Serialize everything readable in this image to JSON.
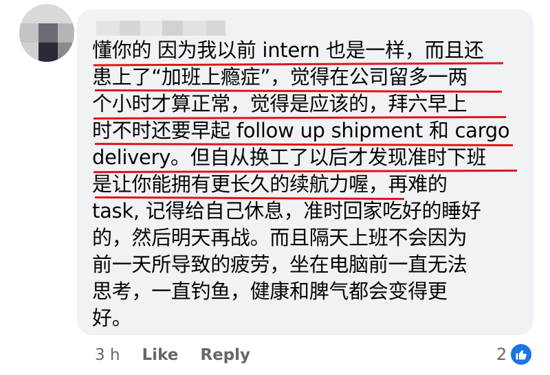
{
  "comment": {
    "author_name": "",
    "lines": [
      "懂你的 因为我以前 intern 也是一样，而且还",
      "患上了“加班上瘾症”，觉得在公司留多一两",
      "个小时才算正常，觉得是应该的，拜六早上",
      "时不时还要早起 follow up shipment 和 cargo",
      "delivery。但自从换工了以后才发现准时下班",
      "是让你能拥有更长久的续航力喔，再难的",
      "task, 记得给自己休息，准时回家吃好的睡好",
      "的，然后明天再战。而且隔天上班不会因为",
      "前一天所导致的疲劳，坐在电脑前一直无法",
      "思考，一直钓鱼，健康和脾气都会变得更",
      "好。"
    ],
    "underlined_lines": 6,
    "underline_color": "#e2131b"
  },
  "actions": {
    "timestamp": "3 h",
    "like_label": "Like",
    "reply_label": "Reply"
  },
  "reactions": {
    "count": "2",
    "icon": "thumbs-up-icon",
    "icon_color": "#1b74e4"
  },
  "colors": {
    "bubble": "#f0f2f5",
    "text": "#050505",
    "meta": "#65676b"
  }
}
